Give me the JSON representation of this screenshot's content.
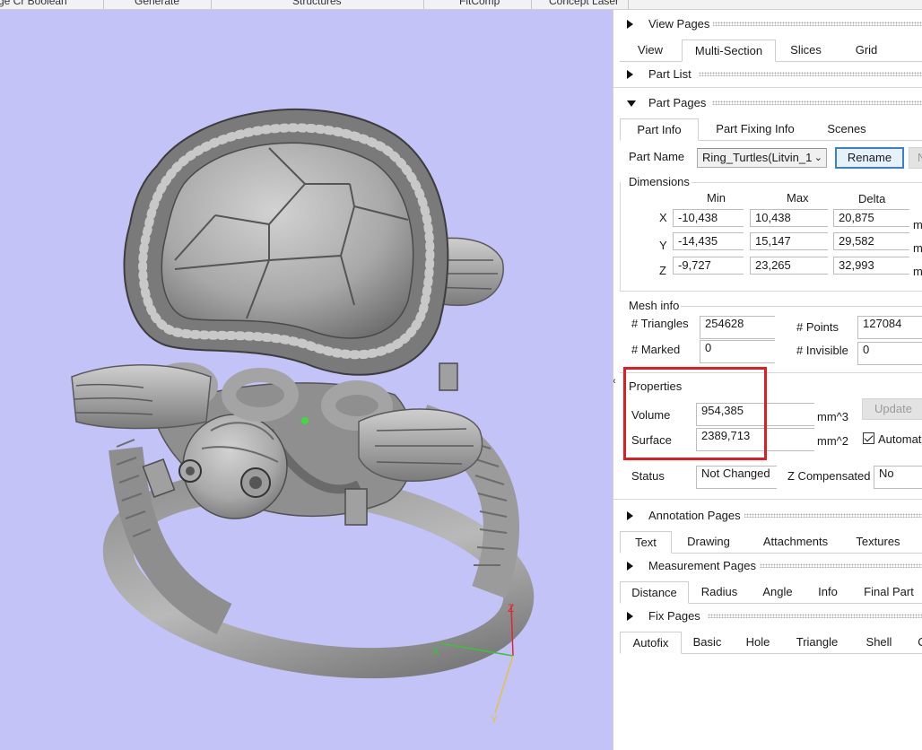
{
  "topbar": {
    "items": [
      "ge Cr Boolean",
      "Generate",
      "Structures",
      "FitComp",
      "Concept Laser"
    ]
  },
  "viewport": {
    "background": "#c3c3f7",
    "axes": {
      "x_label": "X",
      "y_label": "Y",
      "z_label": "Z"
    }
  },
  "panel": {
    "view_pages": {
      "title": "View Pages",
      "tabs": [
        "View",
        "Multi-Section",
        "Slices",
        "Grid"
      ],
      "active": "Multi-Section"
    },
    "part_list": {
      "title": "Part List"
    },
    "part_pages": {
      "title": "Part Pages",
      "tabs": [
        "Part Info",
        "Part Fixing Info",
        "Scenes"
      ],
      "active": "Part Info",
      "part_name_label": "Part Name",
      "part_name_value": "Ring_Turtles(Litvin_1",
      "rename_label": "Rename",
      "next_button_partial": "N",
      "dimensions": {
        "title": "Dimensions",
        "headers": [
          "Min",
          "Max",
          "Delta"
        ],
        "rows": [
          {
            "axis": "X",
            "min": "-10,438",
            "max": "10,438",
            "delta": "20,875",
            "unit": "m"
          },
          {
            "axis": "Y",
            "min": "-14,435",
            "max": "15,147",
            "delta": "29,582",
            "unit": "m"
          },
          {
            "axis": "Z",
            "min": "-9,727",
            "max": "23,265",
            "delta": "32,993",
            "unit": "m"
          }
        ]
      },
      "mesh_info": {
        "title": "Mesh info",
        "triangles_label": "# Triangles",
        "triangles_value": "254628",
        "points_label": "# Points",
        "points_value": "127084",
        "marked_label": "# Marked",
        "marked_value": "0",
        "invisible_label": "# Invisible",
        "invisible_value": "0"
      },
      "properties": {
        "title": "Properties",
        "volume_label": "Volume",
        "volume_value": "954,385",
        "volume_unit": "mm^3",
        "surface_label": "Surface",
        "surface_value": "2389,713",
        "surface_unit": "mm^2",
        "update_label": "Update",
        "automatic_label": "Automat"
      },
      "status": {
        "status_label": "Status",
        "status_value": "Not Changed",
        "zcomp_label": "Z Compensated",
        "zcomp_value": "No"
      }
    },
    "annotation_pages": {
      "title": "Annotation Pages",
      "tabs": [
        "Text",
        "Drawing",
        "Attachments",
        "Textures"
      ],
      "active": "Text"
    },
    "measurement_pages": {
      "title": "Measurement Pages",
      "tabs": [
        "Distance",
        "Radius",
        "Angle",
        "Info",
        "Final Part"
      ],
      "active": "Distance"
    },
    "fix_pages": {
      "title": "Fix Pages",
      "tabs": [
        "Autofix",
        "Basic",
        "Hole",
        "Triangle",
        "Shell",
        "C"
      ],
      "active": "Autofix"
    }
  },
  "colors": {
    "highlight": "#e11d24",
    "rename_border": "#3c7fd1",
    "model_gray": "#9a9a9a"
  }
}
